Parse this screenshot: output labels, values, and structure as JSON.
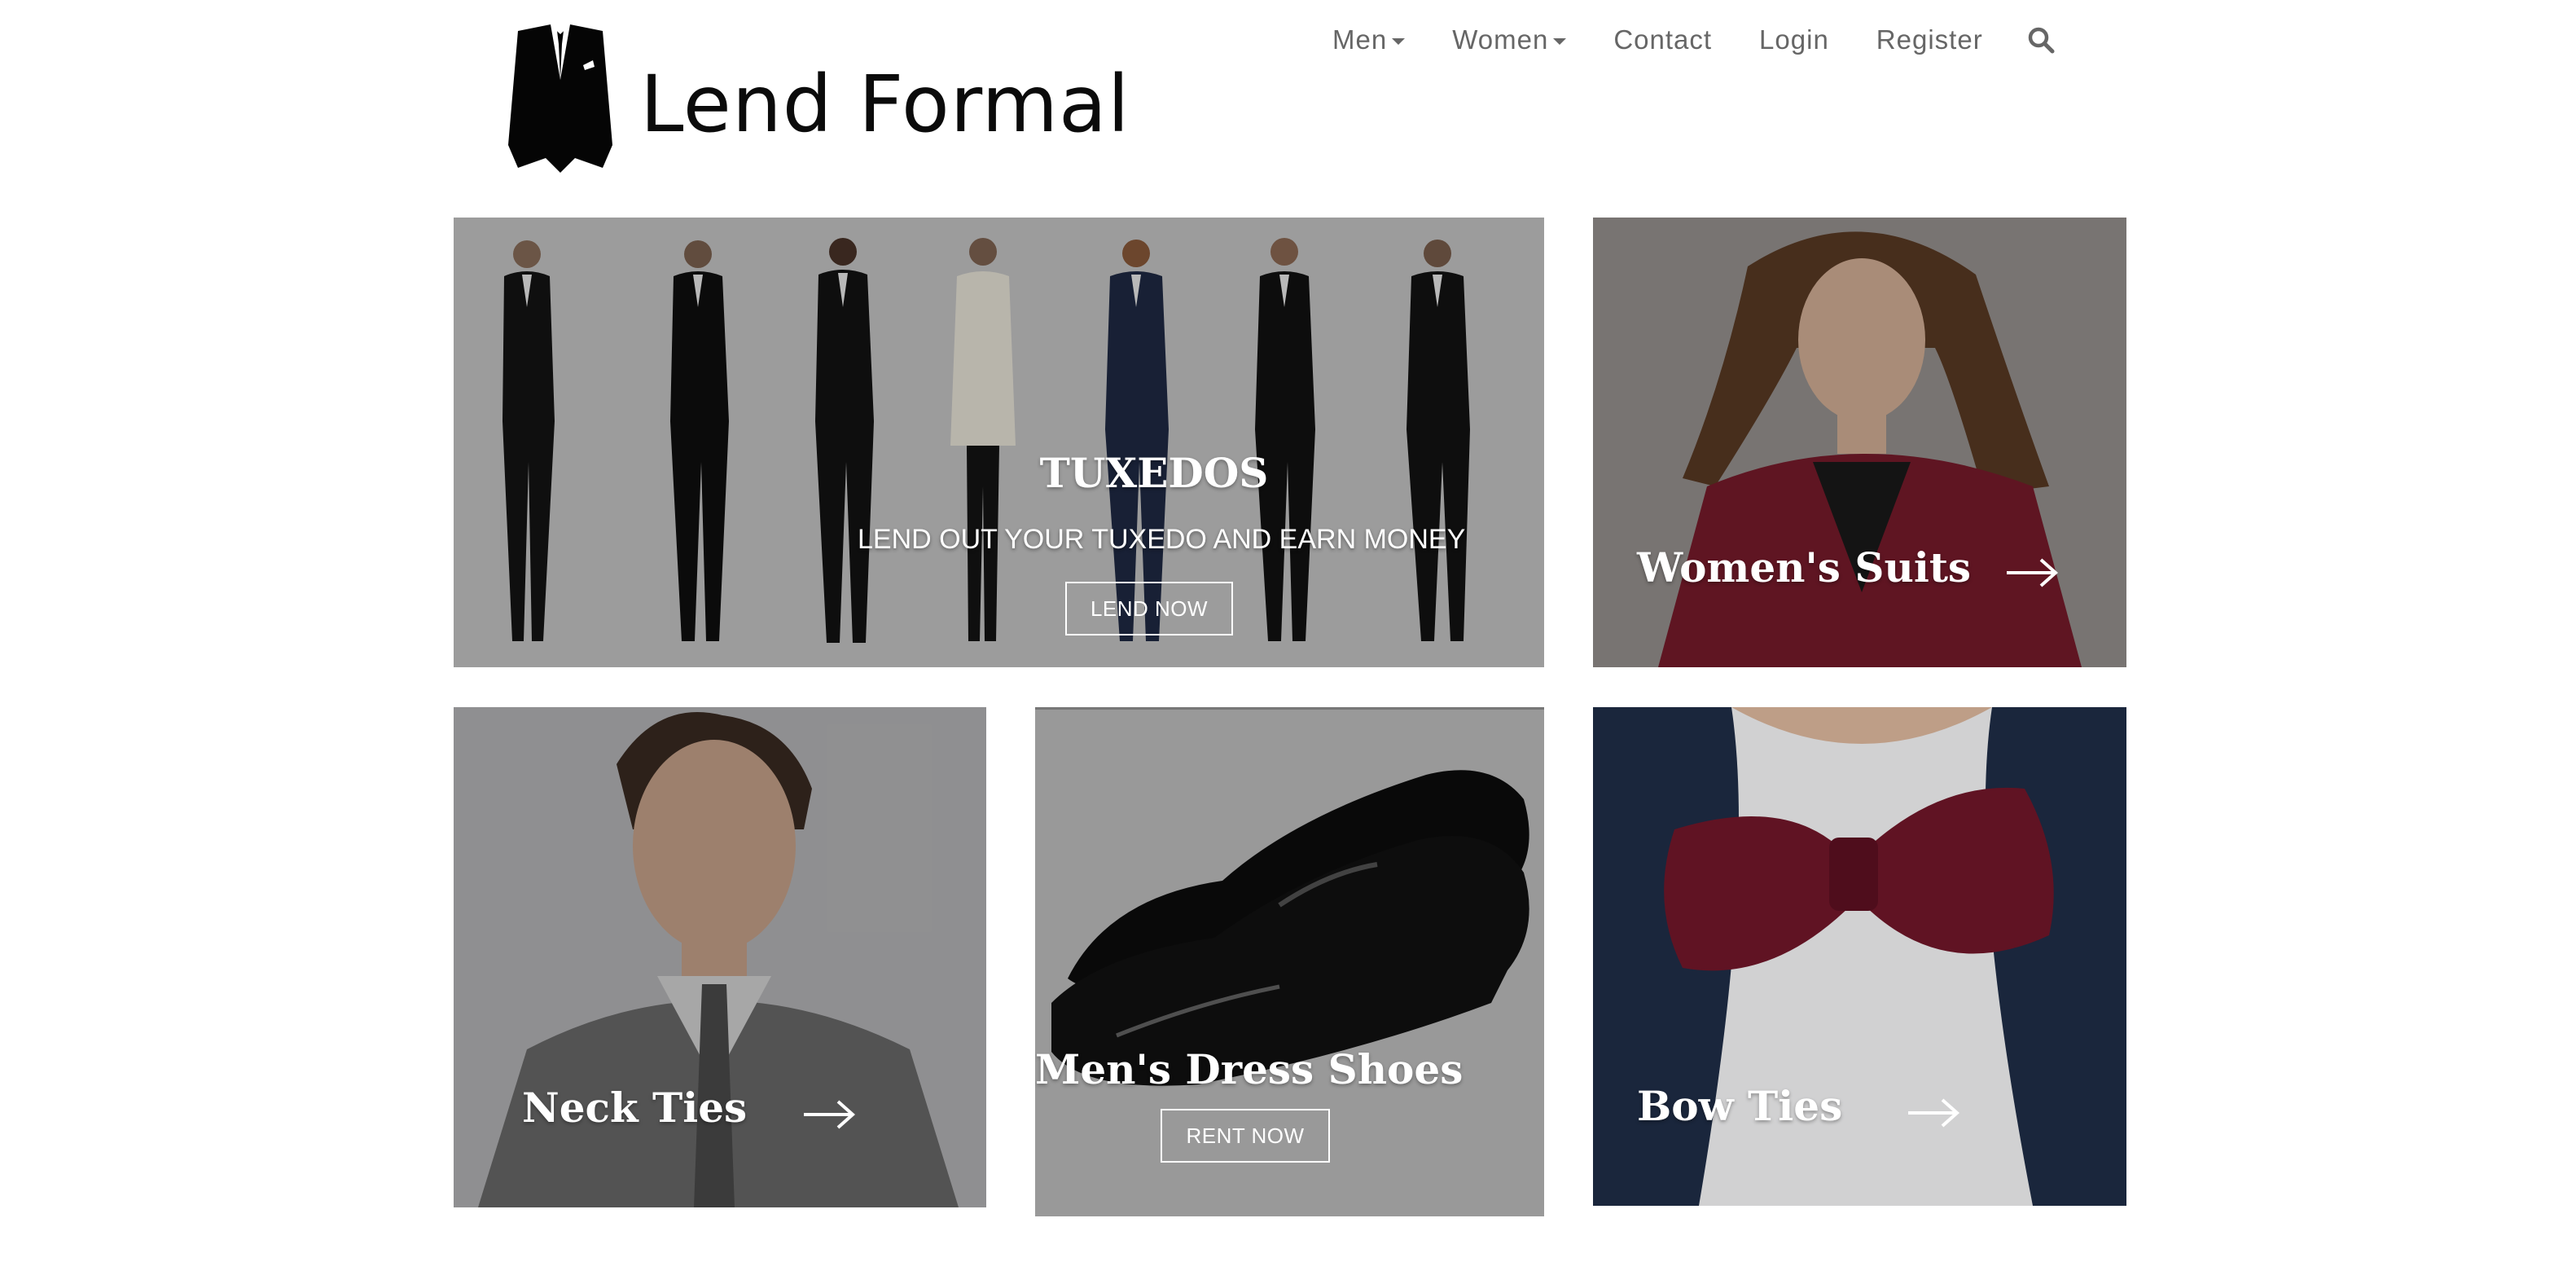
{
  "brand": {
    "name": "Lend Formal",
    "logo_icon": "tuxedo-jacket-icon"
  },
  "nav": {
    "items": [
      {
        "label": "Men",
        "has_dropdown": true
      },
      {
        "label": "Women",
        "has_dropdown": true
      },
      {
        "label": "Contact",
        "has_dropdown": false
      },
      {
        "label": "Login",
        "has_dropdown": false
      },
      {
        "label": "Register",
        "has_dropdown": false
      }
    ],
    "search_icon": "search-icon",
    "text_color": "#666666"
  },
  "tiles": {
    "tuxedos": {
      "title": "TUXEDOS",
      "subtitle": "LEND OUT YOUR TUXEDO AND EARN MONEY",
      "button": "LEND NOW"
    },
    "womens_suits": {
      "title": "Women's Suits",
      "icon": "arrow-right-icon"
    },
    "neck_ties": {
      "title": "Neck Ties",
      "icon": "arrow-right-icon"
    },
    "mens_dress_shoes": {
      "title": "Men's Dress Shoes",
      "button": "RENT NOW"
    },
    "bow_ties": {
      "title": "Bow Ties",
      "icon": "arrow-right-icon"
    }
  },
  "colors": {
    "accent_burgundy": "#7a1c2c",
    "overlay_text": "#ffffff"
  }
}
